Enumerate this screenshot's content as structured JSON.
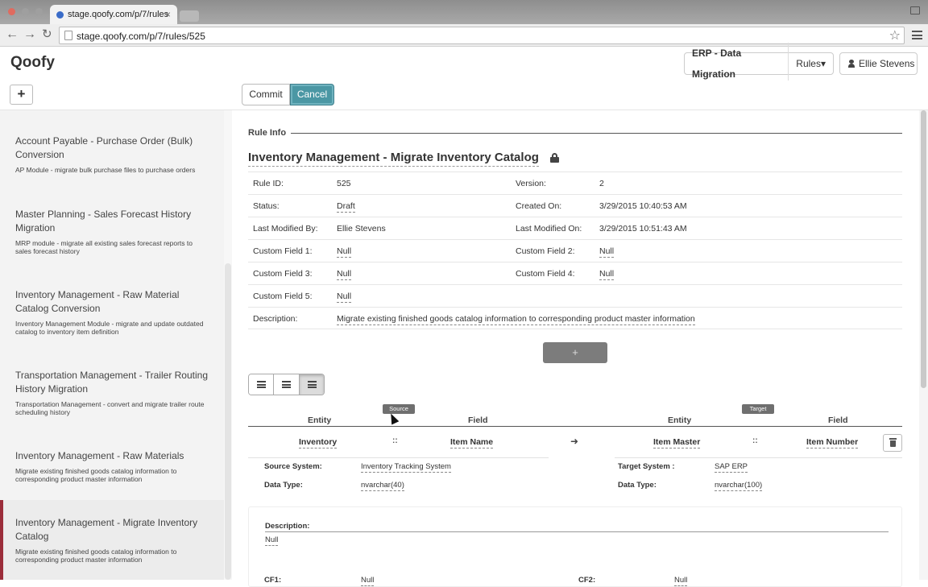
{
  "browser": {
    "tab_title": "stage.qoofy.com/p/7/rules",
    "tab_close": "×",
    "url": "stage.qoofy.com/p/7/rules/525"
  },
  "header": {
    "brand": "Qoofy",
    "project": "ERP - Data Migration",
    "rules_menu": "Rules▾",
    "user": "Ellie Stevens"
  },
  "toolbar": {
    "add_label": "+",
    "commit_label": "Commit",
    "cancel_label": "Cancel"
  },
  "sidebar": {
    "items": [
      {
        "title": "Account Payable - Purchase Order (Bulk) Conversion",
        "desc": "AP Module - migrate bulk purchase files to purchase orders"
      },
      {
        "title": "Master Planning - Sales Forecast History Migration",
        "desc": "MRP module - migrate all existing sales forecast reports to sales forecast history"
      },
      {
        "title": "Inventory Management - Raw Material Catalog Conversion",
        "desc": "Inventory Management Module - migrate and update outdated catalog to inventory item definition"
      },
      {
        "title": "Transportation Management - Trailer Routing History Migration",
        "desc": "Transportation Management - convert and migrate trailer route scheduling history"
      },
      {
        "title": "Inventory Management - Raw Materials",
        "desc": "Migrate existing finished goods catalog information to corresponding product master information"
      },
      {
        "title": "Inventory Management - Migrate Inventory Catalog",
        "desc": "Migrate existing finished goods catalog information to corresponding product master information"
      }
    ]
  },
  "rule": {
    "section_title": "Rule Info",
    "name": "Inventory Management - Migrate Inventory Catalog",
    "info": {
      "rule_id_label": "Rule ID:",
      "rule_id": "525",
      "version_label": "Version:",
      "version": "2",
      "status_label": "Status:",
      "status": "Draft",
      "created_label": "Created On:",
      "created": "3/29/2015 10:40:53 AM",
      "modified_by_label": "Last Modified By:",
      "modified_by": "Ellie Stevens",
      "modified_on_label": "Last Modified On:",
      "modified_on": "3/29/2015 10:51:43 AM",
      "cf1_label": "Custom Field 1:",
      "cf1": "Null",
      "cf2_label": "Custom Field 2:",
      "cf2": "Null",
      "cf3_label": "Custom Field 3:",
      "cf3": "Null",
      "cf4_label": "Custom Field 4:",
      "cf4": "Null",
      "cf5_label": "Custom Field 5:",
      "cf5": "Null",
      "description_label": "Description:",
      "description": "Migrate existing finished goods catalog information to corresponding product master information"
    },
    "add_mapping_label": "+"
  },
  "mapping": {
    "source_tag": "Source",
    "target_tag": "Target",
    "entity_header": "Entity",
    "field_header": "Field",
    "separator": "::",
    "source_entity": "Inventory",
    "source_field": "Item Name",
    "target_entity": "Item Master",
    "target_field": "Item Number",
    "source_system_label": "Source System:",
    "source_system": "Inventory Tracking System",
    "source_type_label": "Data Type:",
    "source_type": "nvarchar(40)",
    "target_system_label": "Target System :",
    "target_system": "SAP ERP",
    "target_type_label": "Data Type:",
    "target_type": "nvarchar(100)",
    "description_label": "Description:",
    "description": "Null",
    "cf1_label": "CF1:",
    "cf1": "Null",
    "cf2_label": "CF2:",
    "cf2": "Null"
  },
  "colors": {
    "accent": "#4b97a4",
    "active_marker": "#9b2d3a"
  },
  "icons": [
    "back-icon",
    "forward-icon",
    "reload-icon",
    "star-icon",
    "menu-icon",
    "user-icon",
    "lock-icon",
    "list-icon",
    "trash-icon",
    "arrow-right-icon"
  ]
}
